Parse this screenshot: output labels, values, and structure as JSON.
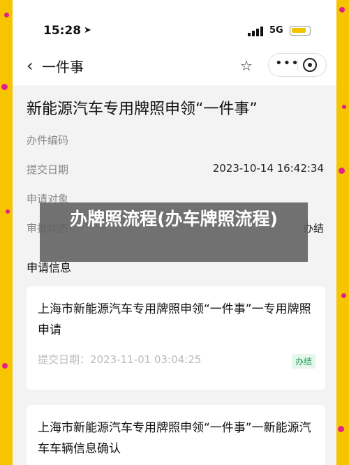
{
  "status": {
    "time": "15:28",
    "network": "5G"
  },
  "nav": {
    "title": "一件事"
  },
  "page": {
    "title": "新能源汽车专用牌照申领“一件事”"
  },
  "fields": [
    {
      "label": "办件编码",
      "value": ""
    },
    {
      "label": "提交日期",
      "value": "2023-10-14 16:42:34"
    },
    {
      "label": "申请对象",
      "value": ""
    },
    {
      "label": "审批状态",
      "value": "办结"
    }
  ],
  "section_title": "申请信息",
  "cards": [
    {
      "title": "上海市新能源汽车专用牌照申领“一件事”一专用牌照申请",
      "date": "提交日期：2023-11-01 03:04:25",
      "badge": "办结"
    },
    {
      "title": "上海市新能源汽车专用牌照申领“一件事”一新能源汽车车辆信息确认",
      "date": "",
      "badge": ""
    }
  ],
  "overlay": {
    "text": "办牌照流程(办车牌照流程)"
  },
  "colors": {
    "background": "#f7c500",
    "dots": "#e0218a",
    "badge_green": "#1f9d55"
  }
}
